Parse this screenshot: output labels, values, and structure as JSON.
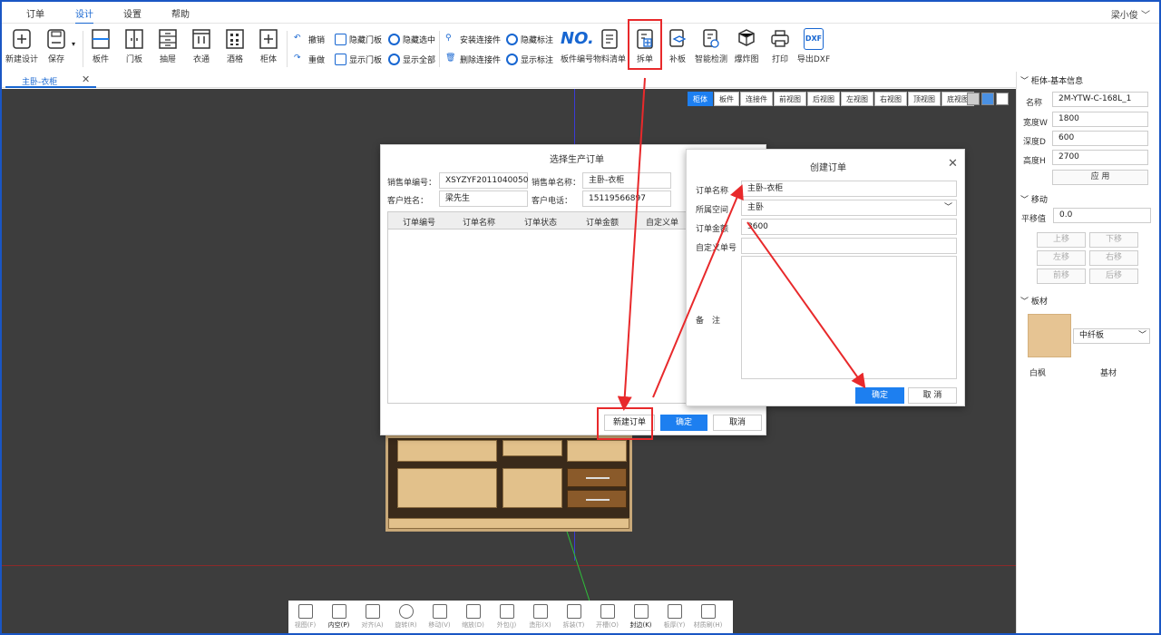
{
  "menu": {
    "items": [
      "订单",
      "设计",
      "设置",
      "帮助"
    ],
    "active": 1,
    "user": "梁小俊 ﹀"
  },
  "toolbar": {
    "file": [
      {
        "label": "新建设计",
        "icon": "new-design-icon"
      },
      {
        "label": "保存",
        "icon": "save-icon"
      }
    ],
    "parts": [
      {
        "label": "板件",
        "icon": "panel-icon"
      },
      {
        "label": "门板",
        "icon": "door-icon"
      },
      {
        "label": "抽屉",
        "icon": "drawer-icon"
      },
      {
        "label": "衣通",
        "icon": "rail-icon"
      },
      {
        "label": "酒格",
        "icon": "wine-rack-icon"
      },
      {
        "label": "柜体",
        "icon": "cabinet-icon"
      }
    ],
    "small": [
      {
        "label": "撤销",
        "icon": "undo-icon"
      },
      {
        "label": "重做",
        "icon": "redo-icon"
      },
      {
        "label": "隐藏门板",
        "icon": "hide-door-icon"
      },
      {
        "label": "显示门板",
        "icon": "show-door-icon"
      },
      {
        "label": "隐藏选中",
        "icon": "hide-selected-icon"
      },
      {
        "label": "显示全部",
        "icon": "show-all-icon"
      },
      {
        "label": "安装连接件",
        "icon": "install-connector-icon"
      },
      {
        "label": "删除连接件",
        "icon": "delete-connector-icon"
      },
      {
        "label": "隐藏标注",
        "icon": "hide-dimension-icon"
      },
      {
        "label": "显示标注",
        "icon": "show-dimension-icon"
      }
    ],
    "no_text": "NO.",
    "right": [
      {
        "label": "板件编号",
        "icon": "panel-number-icon"
      },
      {
        "label": "物料清单",
        "icon": "bom-icon"
      },
      {
        "label": "拆单",
        "icon": "split-order-icon"
      },
      {
        "label": "补板",
        "icon": "patch-board-icon"
      },
      {
        "label": "智能检测",
        "icon": "smart-check-icon"
      },
      {
        "label": "爆炸图",
        "icon": "explode-icon"
      },
      {
        "label": "打印",
        "icon": "print-icon"
      },
      {
        "label": "导出DXF",
        "icon": "export-dxf-icon"
      }
    ],
    "dxf_badge": "DXF"
  },
  "doc_tab": {
    "label": "主卧-衣柜",
    "close": "✕"
  },
  "view_buttons": [
    "柜体",
    "板件",
    "连接件",
    "前视图",
    "后视图",
    "左视图",
    "右视图",
    "顶视图",
    "底视图"
  ],
  "right_panel": {
    "basic_title": "柜体-基本信息",
    "fields": [
      {
        "label": "名称",
        "value": "2M-YTW-C-168L_1"
      },
      {
        "label": "宽度W",
        "value": "1800"
      },
      {
        "label": "深度D",
        "value": "600"
      },
      {
        "label": "高度H",
        "value": "2700"
      }
    ],
    "apply": "应 用",
    "move_title": "移动",
    "offset_label": "平移值",
    "offset_value": "0.0",
    "move_buttons": [
      "上移",
      "下移",
      "左移",
      "右移",
      "前移",
      "后移"
    ],
    "material_title": "板材",
    "material_select": "中纤板",
    "material_name": "白枫",
    "material_base": "基材"
  },
  "order_dialog": {
    "title": "选择生产订单",
    "sales_no_label": "销售单编号：",
    "sales_no": "XSYZYF2011040050",
    "sales_name_label": "销售单名称：",
    "sales_name": "主卧-衣柜",
    "customer_label": "客户姓名：",
    "customer": "梁先生",
    "phone_label": "客户电话：",
    "phone": "15119566897",
    "columns": [
      "订单编号",
      "订单名称",
      "订单状态",
      "订单金额",
      "自定义单号"
    ],
    "new_order": "新建订单",
    "confirm": "确定",
    "cancel": "取消"
  },
  "create_dialog": {
    "title": "创建订单",
    "close": "✕",
    "name_label": "订单名称",
    "name_value": "主卧-衣柜",
    "space_label": "所属空间",
    "space_value": "主卧",
    "amount_label": "订单金额",
    "amount_value": "3600",
    "custom_label": "自定义单号",
    "custom_value": "",
    "remark_label": "备　注",
    "confirm": "确定",
    "cancel": "取 消"
  },
  "bottom_tools": [
    {
      "label": "视图(F)",
      "icon": "view-icon"
    },
    {
      "label": "内空(P)",
      "icon": "inner-space-icon"
    },
    {
      "label": "对齐(A)",
      "icon": "align-icon"
    },
    {
      "label": "旋转(R)",
      "icon": "rotate-icon"
    },
    {
      "label": "移动(V)",
      "icon": "move-icon"
    },
    {
      "label": "缩放(D)",
      "icon": "scale-icon"
    },
    {
      "label": "外包(J)",
      "icon": "wrap-icon"
    },
    {
      "label": "造形(X)",
      "icon": "shape-icon"
    },
    {
      "label": "拆装(T)",
      "icon": "disassemble-icon"
    },
    {
      "label": "开槽(O)",
      "icon": "groove-icon"
    },
    {
      "label": "封边(K)",
      "icon": "edge-band-icon"
    },
    {
      "label": "板厚(Y)",
      "icon": "thickness-icon"
    },
    {
      "label": "材质刷(H)",
      "icon": "material-brush-icon"
    }
  ],
  "colors": {
    "accent": "#1d7ff0",
    "highlight": "#e8292b",
    "viewport": "#3d3d3d",
    "wood": "#e2c18b"
  }
}
